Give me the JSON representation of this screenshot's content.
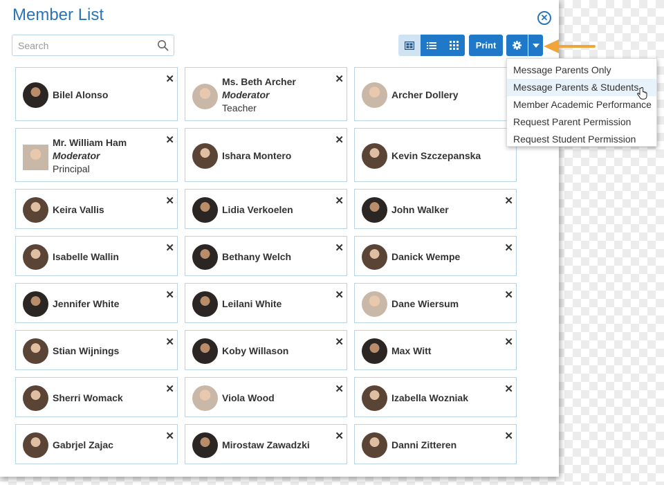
{
  "dialog": {
    "title": "Member List"
  },
  "search": {
    "placeholder": "Search"
  },
  "toolbar": {
    "print_label": "Print"
  },
  "actions_menu": {
    "items": [
      "Message Parents Only",
      "Message Parents & Students",
      "Member Academic Performance",
      "Request Parent Permission",
      "Request Student Permission"
    ]
  },
  "members": [
    {
      "name": "Bilel Alonso",
      "role": "",
      "title": ""
    },
    {
      "name": "Ms. Beth Archer",
      "role": "Moderator",
      "title": "Teacher"
    },
    {
      "name": "Archer Dollery",
      "role": "",
      "title": ""
    },
    {
      "name": "Mr. William Ham",
      "role": "Moderator",
      "title": "Principal"
    },
    {
      "name": "Ishara Montero",
      "role": "",
      "title": ""
    },
    {
      "name": "Kevin Szczepanska",
      "role": "",
      "title": ""
    },
    {
      "name": "Keira Vallis",
      "role": "",
      "title": ""
    },
    {
      "name": "Lidia Verkoelen",
      "role": "",
      "title": ""
    },
    {
      "name": "John Walker",
      "role": "",
      "title": ""
    },
    {
      "name": "Isabelle Wallin",
      "role": "",
      "title": ""
    },
    {
      "name": "Bethany Welch",
      "role": "",
      "title": ""
    },
    {
      "name": "Danick Wempe",
      "role": "",
      "title": ""
    },
    {
      "name": "Jennifer White",
      "role": "",
      "title": ""
    },
    {
      "name": "Leilani White",
      "role": "",
      "title": ""
    },
    {
      "name": "Dane Wiersum",
      "role": "",
      "title": ""
    },
    {
      "name": "Stian Wijnings",
      "role": "",
      "title": ""
    },
    {
      "name": "Koby Willason",
      "role": "",
      "title": ""
    },
    {
      "name": "Max Witt",
      "role": "",
      "title": ""
    },
    {
      "name": "Sherri Womack",
      "role": "",
      "title": ""
    },
    {
      "name": "Viola Wood",
      "role": "",
      "title": ""
    },
    {
      "name": "Izabella Wozniak",
      "role": "",
      "title": ""
    },
    {
      "name": "Gabrjel Zajac",
      "role": "",
      "title": ""
    },
    {
      "name": "Mirostaw Zawadzki",
      "role": "",
      "title": ""
    },
    {
      "name": "Danni Zitteren",
      "role": "",
      "title": ""
    }
  ],
  "icons": {
    "close": "close-circle-icon",
    "search": "search-icon",
    "remove": "x-icon",
    "settings": "gear-icon",
    "caret": "caret-down-icon",
    "view_cards": "card-view-icon",
    "view_list": "list-view-icon",
    "view_grid": "grid-view-icon",
    "cursor": "hand-cursor-icon",
    "callout": "arrow-left-icon"
  },
  "colors": {
    "accent": "#1f78c8",
    "title": "#2a74b8",
    "active_view": "#cfe3f3",
    "card_border": "#b8d3e6",
    "arrow": "#f0a53a"
  }
}
